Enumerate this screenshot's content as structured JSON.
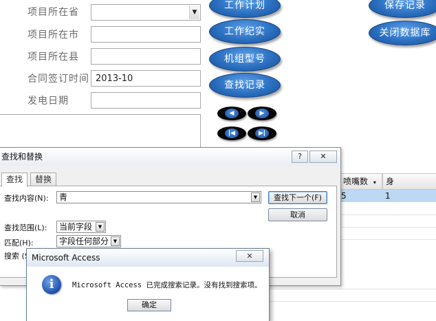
{
  "form": {
    "fields": [
      {
        "label": "项目所在省",
        "value": "",
        "type": "combo"
      },
      {
        "label": "项目所在市",
        "value": ""
      },
      {
        "label": "项目所在县",
        "value": ""
      },
      {
        "label": "合同签订时间",
        "value": "2013-10"
      },
      {
        "label": "发电日期",
        "value": ""
      }
    ]
  },
  "buttons": {
    "work_plan": "工作计划",
    "work_record": "工作纪实",
    "unit_model": "机组型号",
    "find_record": "查找记录",
    "save_record": "保存记录",
    "close_db": "关闭数据库"
  },
  "nav": {
    "prev": "◀",
    "next": "▶",
    "first": "|◀",
    "last": "▶|"
  },
  "find_dialog": {
    "title": "查找和替换",
    "help": "?",
    "close": "✕",
    "tabs": [
      "查找",
      "替换"
    ],
    "find_label": "查找内容(N):",
    "find_value": "青",
    "scope_label": "查找范围(L):",
    "scope_value": "当前字段",
    "match_label": "匹配(H):",
    "match_value": "字段任何部分",
    "search_label": "搜索 (S",
    "find_next": "查找下一个(F)",
    "cancel": "取消"
  },
  "table": {
    "headers": [
      "喷嘴数",
      "身"
    ],
    "row": [
      "5",
      "1"
    ]
  },
  "message_box": {
    "title": "Microsoft Access",
    "close": "✕",
    "icon": "info-icon",
    "message": "Microsoft Access 已完成搜索记录。没有找到搜索项。",
    "ok": "确定"
  }
}
